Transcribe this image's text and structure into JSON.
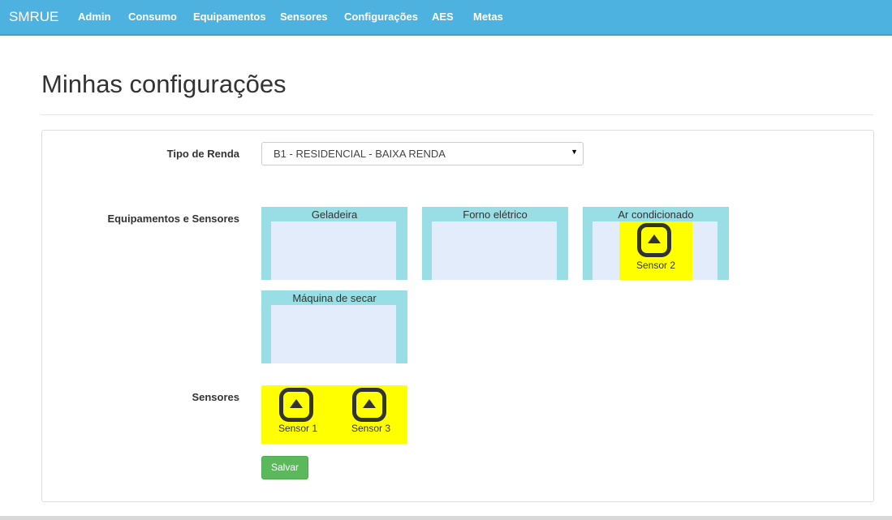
{
  "navbar": {
    "brand": "SMRUE",
    "items": [
      {
        "label": "Admin"
      },
      {
        "label": "Consumo"
      },
      {
        "label": "Equipamentos"
      },
      {
        "label": "Sensores"
      },
      {
        "label": "Configurações"
      },
      {
        "label": "AES"
      },
      {
        "label": "Metas"
      }
    ]
  },
  "page": {
    "title": "Minhas configurações"
  },
  "form": {
    "tipo_renda": {
      "label": "Tipo de Renda",
      "selected": "B1 - RESIDENCIAL - BAIXA RENDA"
    },
    "equipamentos": {
      "label": "Equipamentos e Sensores",
      "items": [
        {
          "name": "Geladeira"
        },
        {
          "name": "Forno elétrico"
        },
        {
          "name": "Ar condicionado",
          "sensor": "Sensor 2"
        },
        {
          "name": "Máquina de secar"
        }
      ]
    },
    "sensores": {
      "label": "Sensores",
      "items": [
        {
          "name": "Sensor 1"
        },
        {
          "name": "Sensor 3"
        }
      ]
    },
    "save_label": "Salvar"
  },
  "colors": {
    "navbar": "#4db2e0",
    "equipment_frame": "#98dee4",
    "equipment_drop_area": "#e2ecfb",
    "sensor": "#ffff00",
    "save_button": "#5cb85c"
  },
  "icons": {
    "sensor": "sensor-eject-icon",
    "select_arrow": "caret-down-icon"
  }
}
